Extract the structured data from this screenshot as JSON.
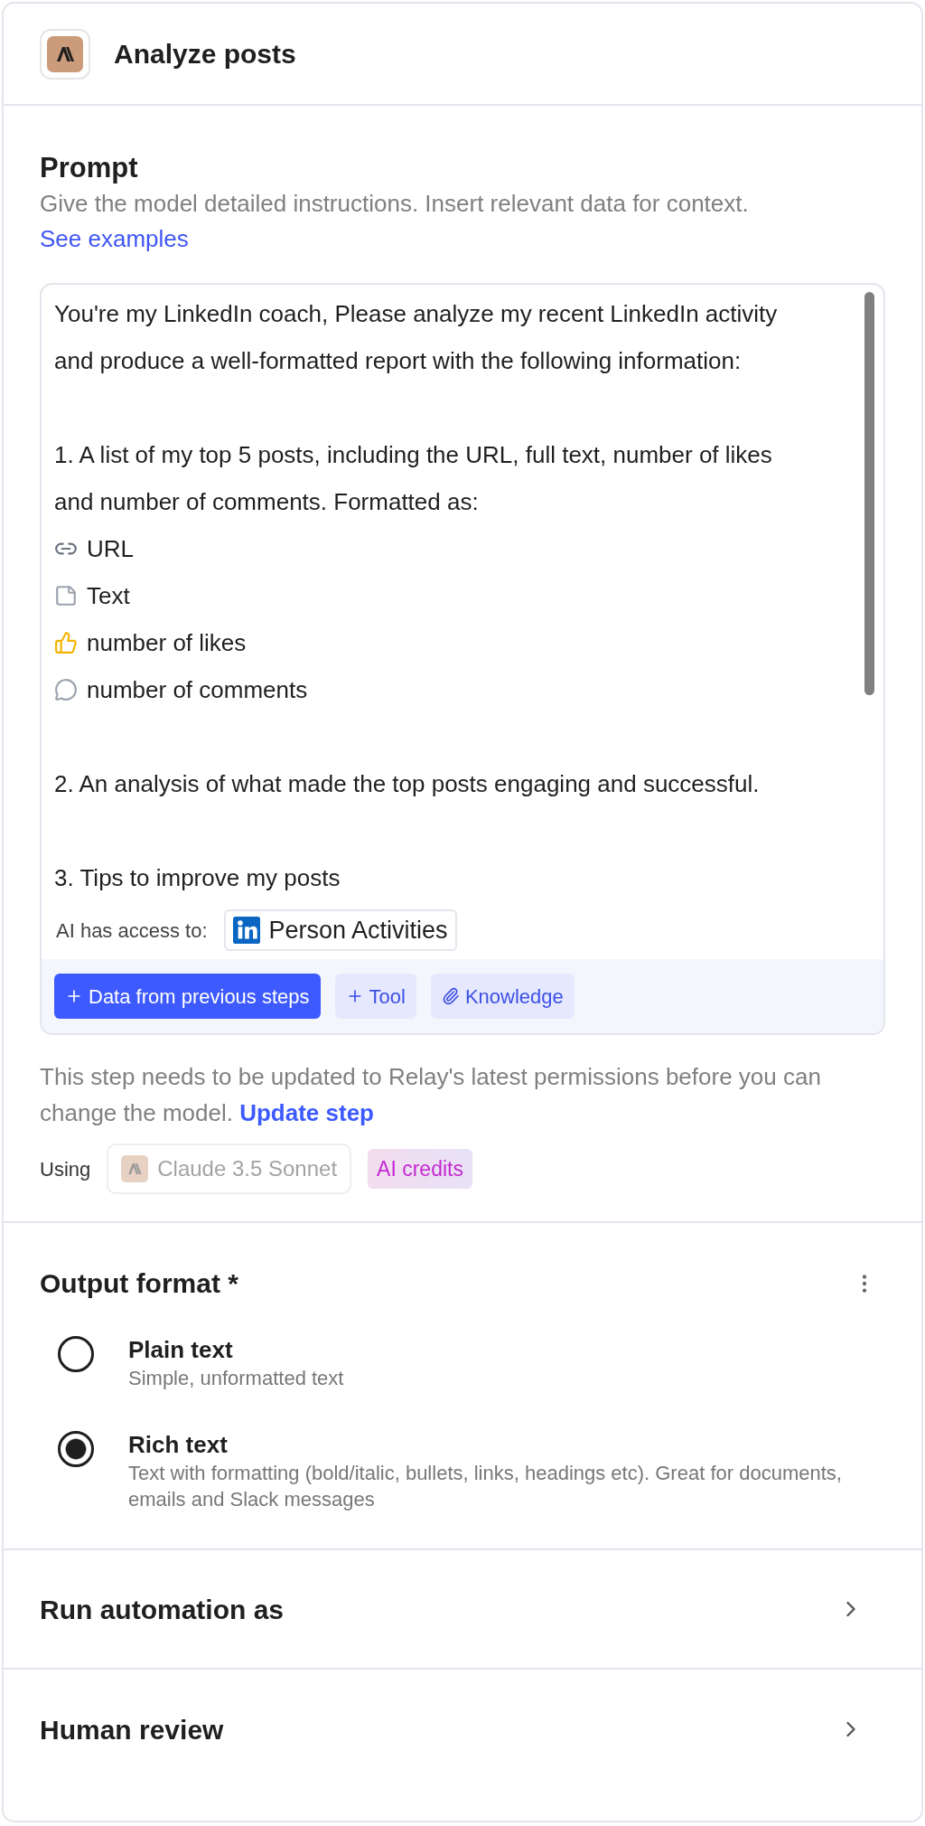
{
  "header": {
    "title": "Analyze posts"
  },
  "prompt": {
    "title": "Prompt",
    "description": "Give the model detailed instructions. Insert relevant data for context.",
    "link": "See examples",
    "paragraphs": [
      [
        {
          "kind": "text",
          "text": "You're my LinkedIn coach, Please analyze my recent LinkedIn activity"
        },
        {
          "kind": "text",
          "text": "and produce a well-formatted report with the following information:"
        }
      ],
      [
        {
          "kind": "text",
          "text": "1. A list of my top 5 posts, including the URL, full text, number of likes"
        },
        {
          "kind": "text",
          "text": "and number of comments. Formatted as:"
        },
        {
          "kind": "link",
          "text": "URL"
        },
        {
          "kind": "note",
          "text": "Text"
        },
        {
          "kind": "likes",
          "text": "number of likes"
        },
        {
          "kind": "comments",
          "text": "number of comments"
        }
      ],
      [
        {
          "kind": "text",
          "text": "2. An analysis of what made the top posts engaging and successful."
        }
      ],
      [
        {
          "kind": "text",
          "text": "3. Tips to improve my posts"
        }
      ]
    ],
    "access": {
      "label": "AI has access to:",
      "items": [
        {
          "label": "Person Activities"
        }
      ]
    },
    "actions": [
      {
        "kind": "primary",
        "label": "Data from previous steps"
      },
      {
        "kind": "add",
        "label": "Tool"
      },
      {
        "kind": "attach",
        "label": "Knowledge"
      }
    ]
  },
  "notice": {
    "text": "This step needs to be updated to Relay's latest permissions before you can change the model.",
    "link": "Update step"
  },
  "model": {
    "label": "Using",
    "name": "Claude 3.5 Sonnet",
    "disabled": true,
    "badge": "AI credits"
  },
  "output": {
    "title": "Output format *",
    "options": [
      {
        "label": "Plain text",
        "description": "Simple, unformatted text",
        "selected": false
      },
      {
        "label": "Rich text",
        "description": "Text with formatting (bold/italic, bullets, links, headings etc). Great for documents, emails and Slack messages",
        "selected": true
      }
    ]
  },
  "sections": [
    {
      "title": "Run automation as"
    },
    {
      "title": "Human review"
    }
  ]
}
